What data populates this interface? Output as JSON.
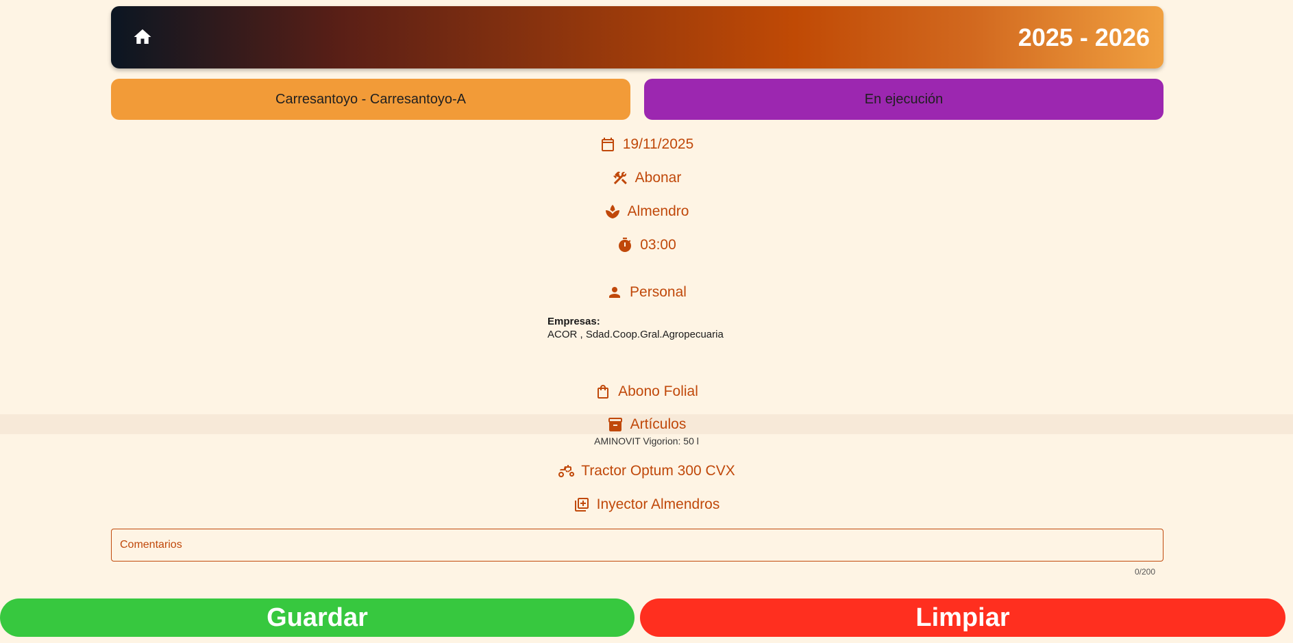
{
  "header": {
    "season": "2025 - 2026"
  },
  "field": {
    "label": "Carresantoyo - Carresantoyo-A"
  },
  "status": {
    "label": "En ejecución"
  },
  "details": {
    "date": "19/11/2025",
    "task": "Abonar",
    "crop": "Almendro",
    "duration": "03:00",
    "personnel": "Personal"
  },
  "empresas": {
    "label": "Empresas:",
    "value": "ACOR , Sdad.Coop.Gral.Agropecuaria"
  },
  "product_type": "Abono Folial",
  "articles": {
    "label": "Artículos",
    "item": "AMINOVIT Vigorion: 50 l"
  },
  "machine": "Tractor Optum 300 CVX",
  "implement": "Inyector Almendros",
  "comments": {
    "placeholder": "Comentarios",
    "value": "",
    "counter": "0/200"
  },
  "actions": {
    "save": "Guardar",
    "clear": "Limpiar"
  },
  "colors": {
    "accent": "#c0480a",
    "save": "#37c83f",
    "clear": "#ff2f1f",
    "field_pill": "#f29b38",
    "status_pill": "#9c27b0"
  }
}
